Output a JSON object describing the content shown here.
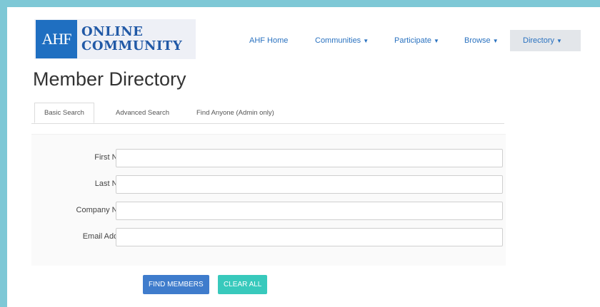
{
  "logo": {
    "mark": "AHF",
    "line1": "ONLINE",
    "line2": "COMMUNITY"
  },
  "nav": {
    "home": "AHF Home",
    "communities": "Communities",
    "participate": "Participate",
    "browse": "Browse",
    "directory": "Directory"
  },
  "page_title": "Member Directory",
  "tabs": {
    "basic": "Basic Search",
    "advanced": "Advanced Search",
    "find_anyone": "Find Anyone (Admin only)"
  },
  "form": {
    "first_name": "First Name",
    "last_name": "Last Name",
    "company_name": "Company Name",
    "email_address": "Email Address"
  },
  "buttons": {
    "find": "FIND MEMBERS",
    "clear": "CLEAR ALL"
  },
  "colors": {
    "frame": "#7ec8d6",
    "link": "#2a72c0",
    "find_button": "#3f7ccc",
    "clear_button": "#38c9bc"
  }
}
